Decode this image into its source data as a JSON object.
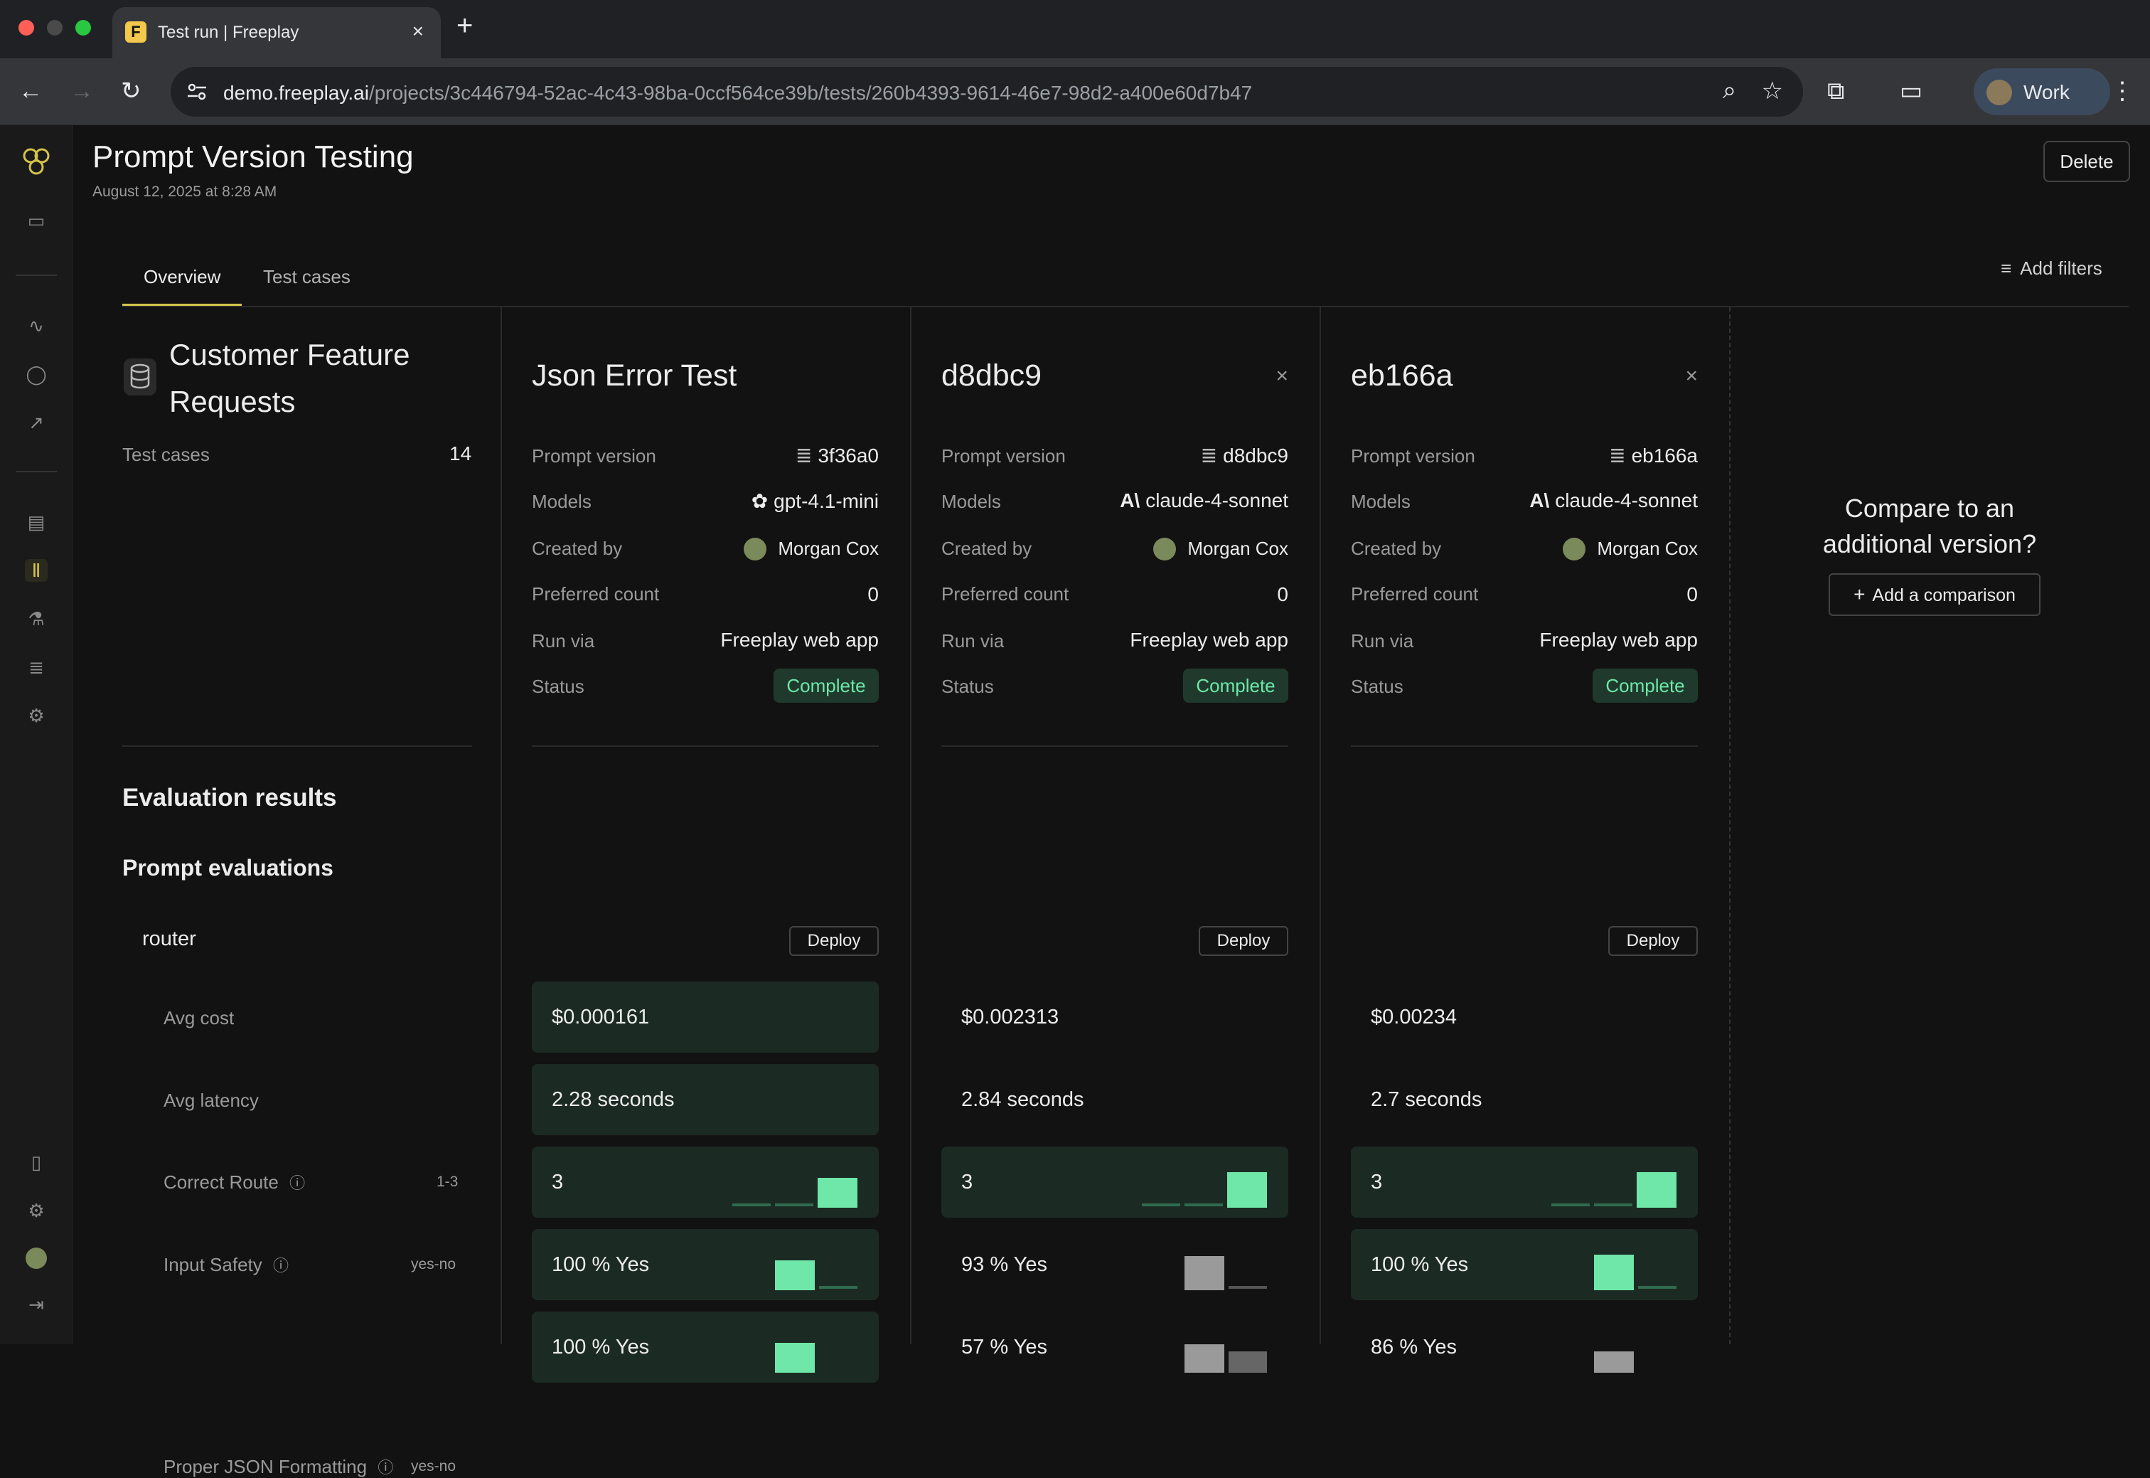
{
  "browser": {
    "tab_title": "Test run | Freeplay",
    "favicon_letter": "F",
    "url_host": "demo.freeplay.ai",
    "url_path": "/projects/3c446794-52ac-4c43-98ba-0ccf564ce39b/tests/260b4393-9614-46e7-98d2-a400e60d7b47",
    "profile_label": "Work"
  },
  "header": {
    "title": "Prompt Version Testing",
    "subtitle": "August 12, 2025 at 8:28 AM",
    "delete_label": "Delete"
  },
  "tabs": [
    {
      "label": "Overview"
    },
    {
      "label": "Test cases"
    }
  ],
  "add_filters_label": "Add filters",
  "dataset": {
    "name_line1": "Customer Feature",
    "name_line2": "Requests",
    "test_cases_label": "Test cases",
    "test_cases_count": "14"
  },
  "labels": {
    "prompt_version": "Prompt version",
    "models": "Models",
    "created_by": "Created by",
    "preferred_count": "Preferred count",
    "run_via": "Run via",
    "status": "Status",
    "deploy": "Deploy"
  },
  "columns": [
    {
      "title": "Json Error Test",
      "prompt_version": "3f36a0",
      "model": "gpt-4.1-mini",
      "creator": "Morgan Cox",
      "preferred": "0",
      "run_via": "Freeplay web app",
      "status": "Complete",
      "avg_cost": "$0.000161",
      "avg_latency": "2.28 seconds",
      "correct_route": "3",
      "input_safety": "100 % Yes",
      "json_formatting": "100 % Yes"
    },
    {
      "title": "d8dbc9",
      "prompt_version": "d8dbc9",
      "model": "claude-4-sonnet",
      "creator": "Morgan Cox",
      "preferred": "0",
      "run_via": "Freeplay web app",
      "status": "Complete",
      "avg_cost": "$0.002313",
      "avg_latency": "2.84 seconds",
      "correct_route": "3",
      "input_safety": "93 % Yes",
      "json_formatting": "57 % Yes"
    },
    {
      "title": "eb166a",
      "prompt_version": "eb166a",
      "model": "claude-4-sonnet",
      "creator": "Morgan Cox",
      "preferred": "0",
      "run_via": "Freeplay web app",
      "status": "Complete",
      "avg_cost": "$0.00234",
      "avg_latency": "2.7 seconds",
      "correct_route": "3",
      "input_safety": "100 % Yes",
      "json_formatting": "86 % Yes"
    }
  ],
  "compare": {
    "line1": "Compare to an",
    "line2": "additional version?",
    "button_label": "Add a comparison"
  },
  "evaluation": {
    "heading": "Evaluation results",
    "prompt_eval_heading": "Prompt evaluations",
    "router_label": "router",
    "rows": [
      {
        "label": "Avg cost",
        "range": ""
      },
      {
        "label": "Avg latency",
        "range": ""
      },
      {
        "label": "Correct Route",
        "range": "1-3"
      },
      {
        "label": "Input Safety",
        "range": "yes-no"
      },
      {
        "label": "Proper JSON Formatting",
        "range": "yes-no"
      }
    ]
  },
  "colors": {
    "accent_green": "#6ee7a8",
    "highlight_bg": "#1c2a24",
    "gray_bar": "#9a9a9a"
  }
}
